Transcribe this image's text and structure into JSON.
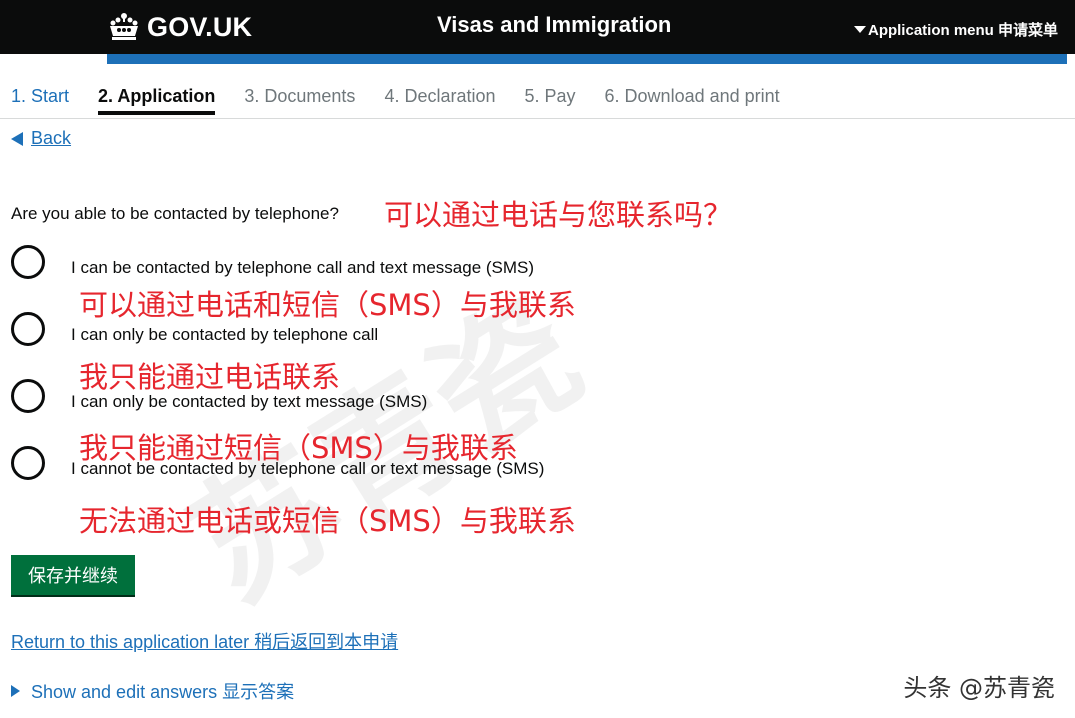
{
  "header": {
    "logo_text": "GOV.UK",
    "service_name": "Visas and Immigration",
    "menu_label": "Application menu 申请菜单"
  },
  "steps": [
    {
      "label": "1. Start",
      "state": "link"
    },
    {
      "label": "2. Application",
      "state": "current"
    },
    {
      "label": "3. Documents",
      "state": "disabled"
    },
    {
      "label": "4. Declaration",
      "state": "disabled"
    },
    {
      "label": "5. Pay",
      "state": "disabled"
    },
    {
      "label": "6. Download and print",
      "state": "disabled"
    }
  ],
  "back_label": "Back",
  "question": {
    "text": "Are you able to be contacted by telephone?",
    "translation": "可以通过电话与您联系吗？"
  },
  "options": [
    {
      "label": "I can be contacted by telephone call and text message (SMS)",
      "translation": "可以通过电话和短信（SMS）与我联系",
      "selected": false
    },
    {
      "label": "I can only be contacted by telephone call",
      "translation": "我只能通过电话联系",
      "selected": false
    },
    {
      "label": "I can only be contacted by text message (SMS)",
      "translation": "我只能通过短信（SMS）与我联系",
      "selected": false
    },
    {
      "label": "I cannot be contacted by telephone call or text message (SMS)",
      "translation": "无法通过电话或短信（SMS）与我联系",
      "selected": false
    }
  ],
  "continue_label": "保存并继续",
  "return_link": "Return to this application later 稍后返回到本申请",
  "details_label": "Show and edit answers 显示答案",
  "watermark": "苏青瓷",
  "signature": "头条 @苏青瓷",
  "colors": {
    "header_bg": "#0b0c0c",
    "brand_blue": "#1d70b8",
    "button_green": "#00703c",
    "annotation_red": "#e6262e"
  }
}
